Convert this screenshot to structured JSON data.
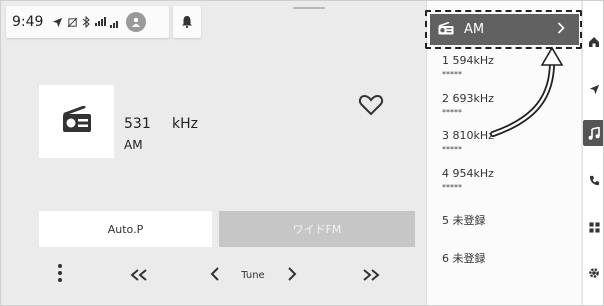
{
  "status_bar": {
    "time": "9:49",
    "icons": [
      "navigation-arrow-icon",
      "no-phone-icon",
      "bluetooth-icon",
      "signal-dcm-icon",
      "signal-icon",
      "user-avatar-icon"
    ]
  },
  "notification": {
    "icon": "bell-icon"
  },
  "now_playing": {
    "frequency_value": "531",
    "frequency_unit": "kHz",
    "band": "AM",
    "favorite_icon": "heart-outline-icon",
    "source_icon": "radio-icon"
  },
  "buttons": {
    "auto_p": "Auto.P",
    "wide_fm": "ワイドFM"
  },
  "controls": {
    "tune_label": "Tune"
  },
  "list": {
    "source_label": "AM",
    "presets": [
      {
        "name": "1  594kHz",
        "stars": "*****"
      },
      {
        "name": "2  693kHz",
        "stars": "*****"
      },
      {
        "name": "3  810kHz",
        "stars": "*****"
      },
      {
        "name": "4  954kHz",
        "stars": "*****"
      },
      {
        "name": "5  未登録",
        "stars": ""
      },
      {
        "name": "6  未登録",
        "stars": ""
      }
    ]
  },
  "nav": [
    "home-icon",
    "navigation-icon",
    "music-icon",
    "phone-icon",
    "apps-icon",
    "settings-icon"
  ],
  "colors": {
    "background": "#ebebeb",
    "header_dark": "#616161",
    "disabled_button": "#c6c6c6",
    "panel": "#fbfbfb"
  }
}
